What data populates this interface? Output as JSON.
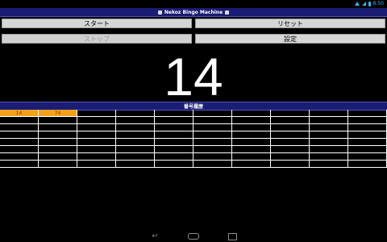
{
  "status": {
    "time": "8:50"
  },
  "app": {
    "title": "Nekoz Bingo Machine"
  },
  "buttons": {
    "start": "スタート",
    "reset": "リセット",
    "stop": "ストップ",
    "settings": "設定"
  },
  "current_number": "14",
  "history": {
    "header": "番号履歴",
    "columns": 10,
    "rows": 8,
    "cells": [
      "14",
      "74"
    ]
  },
  "colors": {
    "title_bar": "#1b1c73",
    "called_cell": "#f2a11d",
    "status_icons": "#33b5e5"
  },
  "nav": {
    "back_icon": "back-icon",
    "home_icon": "home-icon",
    "recent_icon": "recent-apps-icon"
  }
}
